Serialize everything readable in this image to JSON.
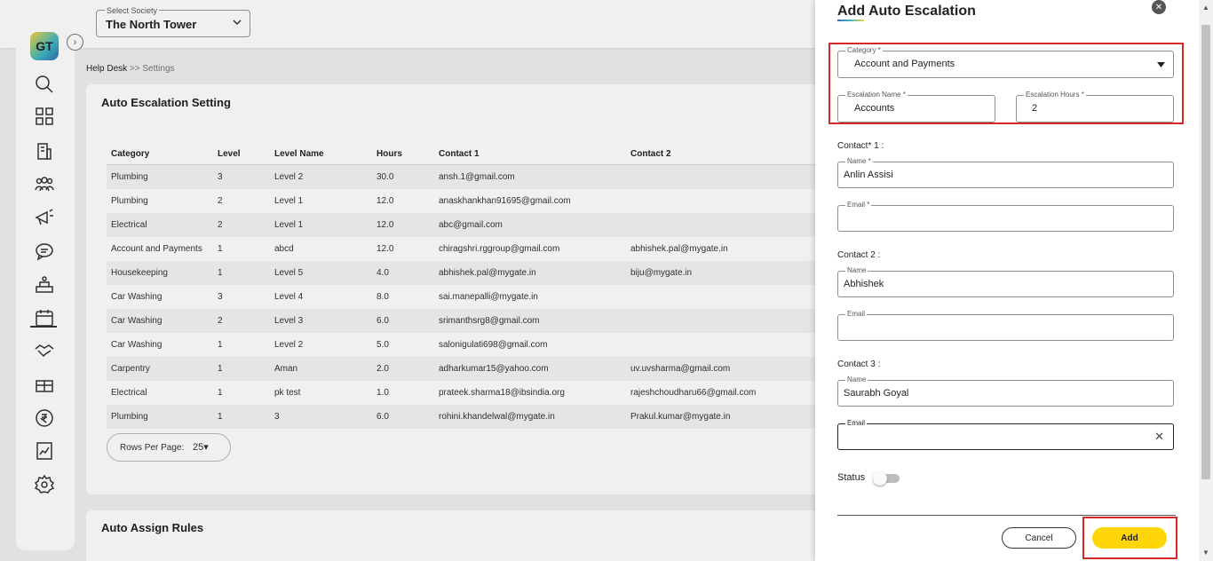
{
  "society": {
    "label": "Select Society",
    "value": "The North Tower"
  },
  "sidebar": {
    "logo_text": "GT",
    "icons": [
      "search-icon",
      "dashboard-icon",
      "building-icon",
      "residents-icon",
      "announcement-icon",
      "chat-icon",
      "helpdesk-icon",
      "calendar-icon",
      "handshake-icon",
      "gift-icon",
      "rupee-icon",
      "reports-icon",
      "settings-icon"
    ]
  },
  "breadcrumb": {
    "root": "Help Desk",
    "sep": ">>",
    "current": "Settings"
  },
  "escalation_card": {
    "title": "Auto Escalation Setting",
    "columns": [
      "Category",
      "Level",
      "Level Name",
      "Hours",
      "Contact 1",
      "Contact 2"
    ],
    "rows": [
      [
        "Plumbing",
        "3",
        "Level 2",
        "30.0",
        "ansh.1@gmail.com",
        ""
      ],
      [
        "Plumbing",
        "2",
        "Level 1",
        "12.0",
        "anaskhankhan91695@gmail.com",
        ""
      ],
      [
        "Electrical",
        "2",
        "Level 1",
        "12.0",
        "abc@gmail.com",
        ""
      ],
      [
        "Account and Payments",
        "1",
        "abcd",
        "12.0",
        "chiragshri.rggroup@gmail.com",
        "abhishek.pal@mygate.in"
      ],
      [
        "Housekeeping",
        "1",
        "Level 5",
        "4.0",
        "abhishek.pal@mygate.in",
        "biju@mygate.in"
      ],
      [
        "Car Washing",
        "3",
        "Level 4",
        "8.0",
        "sai.manepalli@mygate.in",
        ""
      ],
      [
        "Car Washing",
        "2",
        "Level 3",
        "6.0",
        "srimanthsrg8@gmail.com",
        ""
      ],
      [
        "Car Washing",
        "1",
        "Level 2",
        "5.0",
        "salonigulati698@gmail.com",
        ""
      ],
      [
        "Carpentry",
        "1",
        "Aman",
        "2.0",
        "adharkumar15@yahoo.com",
        "uv.uvsharma@gmail.com"
      ],
      [
        "Electrical",
        "1",
        "pk test",
        "1.0",
        "prateek.sharma18@ibsindia.org",
        "rajeshchoudharu66@gmail.com"
      ],
      [
        "Plumbing",
        "1",
        "3",
        "6.0",
        "rohini.khandelwal@mygate.in",
        "Prakul.kumar@mygate.in"
      ]
    ],
    "rows_per_page_label": "Rows Per Page:",
    "rows_per_page_value": "25"
  },
  "assign_card": {
    "title": "Auto Assign Rules"
  },
  "drawer": {
    "title": "Add Auto Escalation",
    "category": {
      "label": "Category *",
      "value": "Account and Payments"
    },
    "escalation_name": {
      "label": "Escalation Name *",
      "value": "Accounts"
    },
    "escalation_hours": {
      "label": "Escalation Hours *",
      "value": "2"
    },
    "contact1": {
      "heading": "Contact* 1 :",
      "name_label": "Name *",
      "name_value": "Anlin Assisi",
      "email_label": "Email *",
      "email_value": ""
    },
    "contact2": {
      "heading": "Contact 2 :",
      "name_label": "Name",
      "name_value": "Abhishek",
      "email_label": "Email",
      "email_value": ""
    },
    "contact3": {
      "heading": "Contact 3 :",
      "name_label": "Name",
      "name_value": "Saurabh Goyal",
      "email_label": "Email",
      "email_value": ""
    },
    "status_label": "Status",
    "status_on": false,
    "cancel_label": "Cancel",
    "add_label": "Add",
    "highlight_color": "#d62828",
    "add_color": "#ffd60a"
  }
}
